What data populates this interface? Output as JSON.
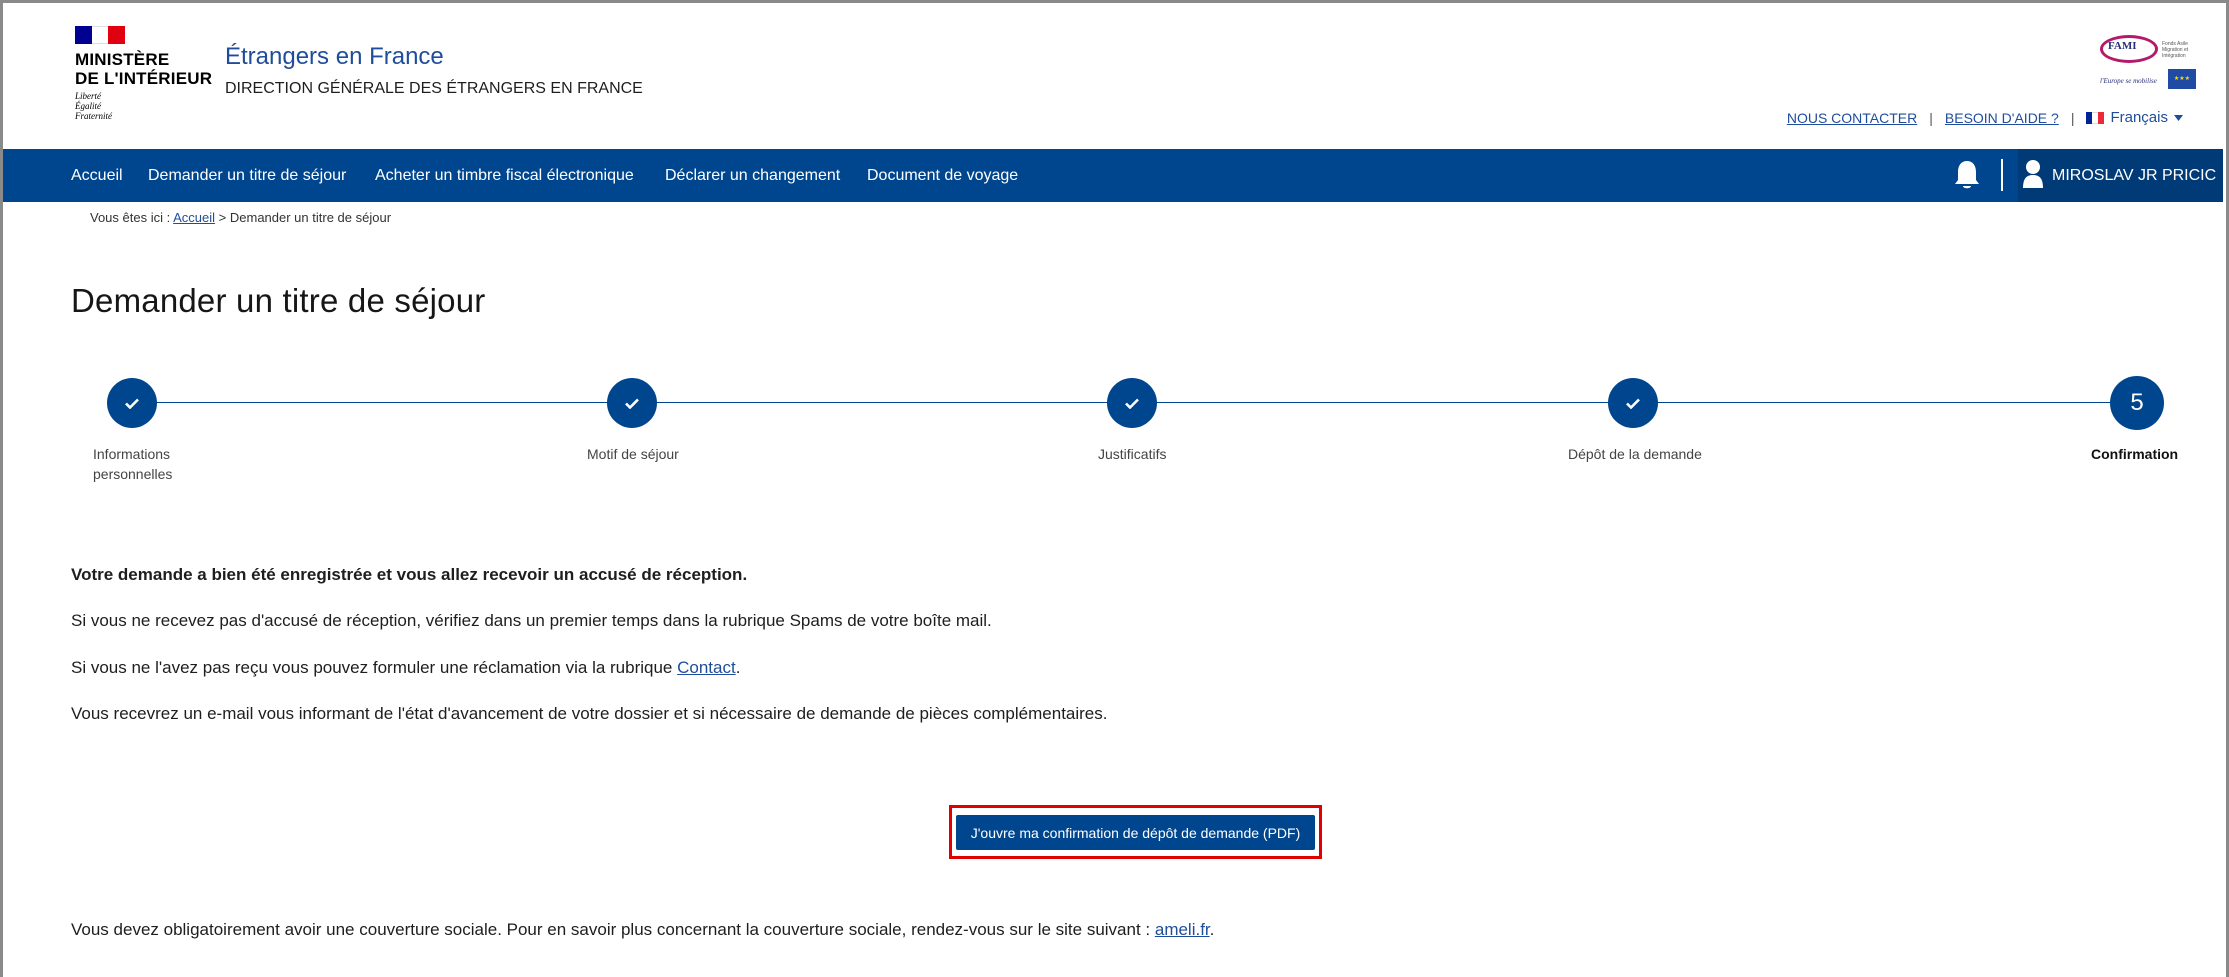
{
  "header": {
    "ministry_line1": "MINISTÈRE",
    "ministry_line2": "DE L'INTÉRIEUR",
    "devise": [
      "Liberté",
      "Égalité",
      "Fraternité"
    ],
    "site_title": "Étrangers en France",
    "site_subtitle": "DIRECTION GÉNÉRALE DES ÉTRANGERS EN FRANCE",
    "fami_logo_text": "FAMI",
    "fami_small_text": "Fonds Asile Migration et Intégration",
    "fami_tagline": "l'Europe se mobilise",
    "links": {
      "contact": "NOUS CONTACTER",
      "help": "BESOIN D'AIDE ?",
      "separator": "|",
      "language": "Français"
    }
  },
  "nav": {
    "items": [
      "Accueil",
      "Demander un titre de séjour",
      "Acheter un timbre fiscal électronique",
      "Déclarer un changement",
      "Document de voyage"
    ],
    "user_name": "MIROSLAV JR PRICIC"
  },
  "breadcrumb": {
    "prefix": "Vous êtes ici :",
    "home": "Accueil",
    "current": "> Demander un titre de séjour"
  },
  "page": {
    "title": "Demander un titre de séjour"
  },
  "stepper": {
    "steps": [
      {
        "label_line1": "Informations",
        "label_line2": "personnelles",
        "status": "completed",
        "icon": "check-icon"
      },
      {
        "label_line1": "Motif de séjour",
        "label_line2": "",
        "status": "completed",
        "icon": "check-icon"
      },
      {
        "label_line1": "Justificatifs",
        "label_line2": "",
        "status": "completed",
        "icon": "check-icon"
      },
      {
        "label_line1": "Dépôt de la demande",
        "label_line2": "",
        "status": "completed",
        "icon": "check-icon"
      },
      {
        "label_line1": "Confirmation",
        "label_line2": "",
        "status": "current",
        "number": "5"
      }
    ]
  },
  "content": {
    "confirmation_heading": "Votre demande a bien été enregistrée et vous allez recevoir un accusé de réception.",
    "spam_note": "Si vous ne recevez pas d'accusé de réception, vérifiez dans un premier temps dans la rubrique Spams de votre boîte mail.",
    "complaint_prefix": "Si vous ne l'avez pas reçu vous pouvez formuler une réclamation via la rubrique ",
    "complaint_link": "Contact",
    "complaint_suffix": ".",
    "email_note": "Vous recevrez un e-mail vous informant de l'état d'avancement de votre dossier et si nécessaire de demande de pièces complémentaires.",
    "pdf_button": "J'ouvre ma confirmation de dépôt de demande (PDF)",
    "social_prefix": "Vous devez obligatoirement avoir une couverture sociale. Pour en savoir plus concernant la couverture sociale, rendez-vous sur le site suivant : ",
    "social_link": "ameli.fr",
    "social_suffix": "."
  },
  "colors": {
    "primary_blue": "#00468f",
    "link_blue": "#1f4d9c",
    "highlight_red": "#e00000"
  }
}
